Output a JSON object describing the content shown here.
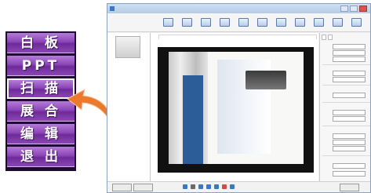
{
  "menu": {
    "items": [
      {
        "label": "白 板",
        "active": false
      },
      {
        "label": "PPT",
        "active": false
      },
      {
        "label": "扫 描",
        "active": true
      },
      {
        "label": "展 合",
        "active": false
      },
      {
        "label": "编 辑",
        "active": false
      },
      {
        "label": "退 出",
        "active": false
      }
    ]
  },
  "colors": {
    "menu_button": "#8c45b8",
    "menu_border": "#1f0a33",
    "arrow": "#ec7a2c",
    "book_band": "#2d5d98"
  },
  "icons": [
    "curved-arrow-icon",
    "toolbar-icon",
    "thumbnail-icon",
    "rotate-icon",
    "zoom-in-icon",
    "zoom-out-icon",
    "fit-icon",
    "crop-icon",
    "settings-icon"
  ]
}
